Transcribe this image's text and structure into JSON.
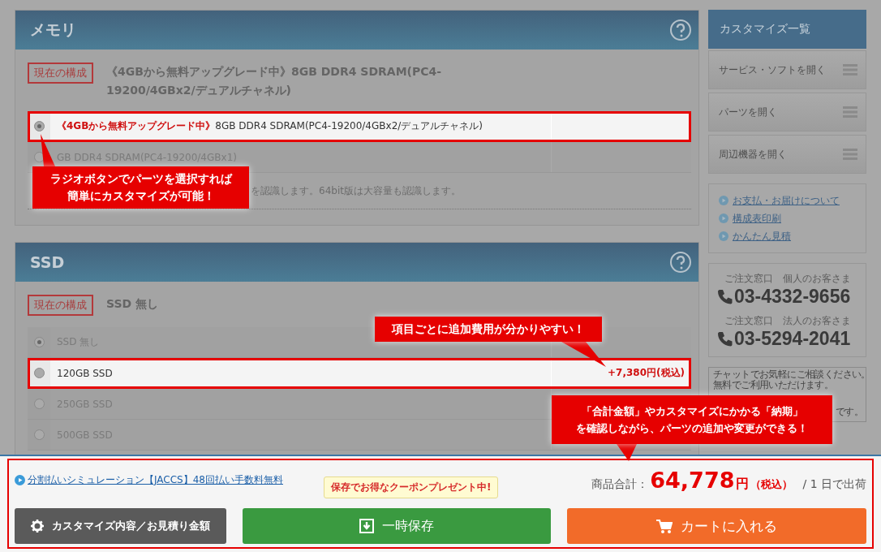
{
  "sections": [
    {
      "title": "メモリ",
      "current_label": "現在の構成",
      "current_value": "《4GBから無料アップグレード中》8GB DDR4 SDRAM(PC4-19200/4GBx2/デュアルチャネル)",
      "options": [
        {
          "promo": "《4GBから無料アップグレード中》",
          "name": "8GB DDR4 SDRAM(PC4-19200/4GBx2/デュアルチャネル)",
          "selected": true,
          "highlighted": true
        },
        {
          "name": "GB DDR4 SDRAM(PC4-19200/4GBx1)",
          "selected": false,
          "highlighted": false
        }
      ],
      "note": "を認識します。64bit版は大容量も認識します。"
    },
    {
      "title": "SSD",
      "current_label": "現在の構成",
      "current_value": "SSD 無し",
      "options": [
        {
          "name": "SSD 無し",
          "selected": true,
          "highlighted": false
        },
        {
          "name": "120GB SSD",
          "price": "+7,380円(税込)",
          "selected": false,
          "highlighted": true
        },
        {
          "name": "250GB SSD",
          "selected": false,
          "highlighted": false
        },
        {
          "name": "500GB SSD",
          "selected": false,
          "highlighted": false
        }
      ]
    }
  ],
  "sidebar": {
    "title": "カスタマイズ一覧",
    "menu": [
      "サービス・ソフトを開く",
      "パーツを開く",
      "周辺機器を開く"
    ],
    "links": [
      "お支払・お届けについて",
      "構成表印刷",
      "かんたん見積"
    ],
    "phones": [
      {
        "label": "ご注文窓口　個人のお客さま",
        "number": "03-4332-9656"
      },
      {
        "label": "ご注文窓口　法人のお客さま",
        "number": "03-5294-2041"
      }
    ],
    "chat": [
      "チャットでお気軽にご相談ください。",
      "無料でご利用いただけます。",
      "です。"
    ]
  },
  "footer": {
    "installment_link": "分割払いシミュレーション【JACCS】48回払い手数料無料",
    "coupon_tip": "保存でお得なクーポンプレゼント中!",
    "total_label": "商品合計：",
    "total_amount": "64,778",
    "total_unit": "円",
    "tax": "（税込）",
    "shipping": "/ 1 日で出荷",
    "buttons": [
      {
        "kind": "estimate",
        "label": "カスタマイズ内容／お見積り金額"
      },
      {
        "kind": "save",
        "label": "一時保存"
      },
      {
        "kind": "cart",
        "label": "カートに入れる"
      }
    ]
  },
  "callouts": [
    {
      "lines": [
        "ラジオボタンでパーツを選択すれば",
        "簡単にカスタマイズが可能！"
      ]
    },
    {
      "lines": [
        "項目ごとに追加費用が分かりやすい！"
      ]
    },
    {
      "lines": [
        "「合計金額」やカスタマイズにかかる「納期」",
        "を確認しながら、パーツの追加や変更ができる！"
      ]
    }
  ]
}
